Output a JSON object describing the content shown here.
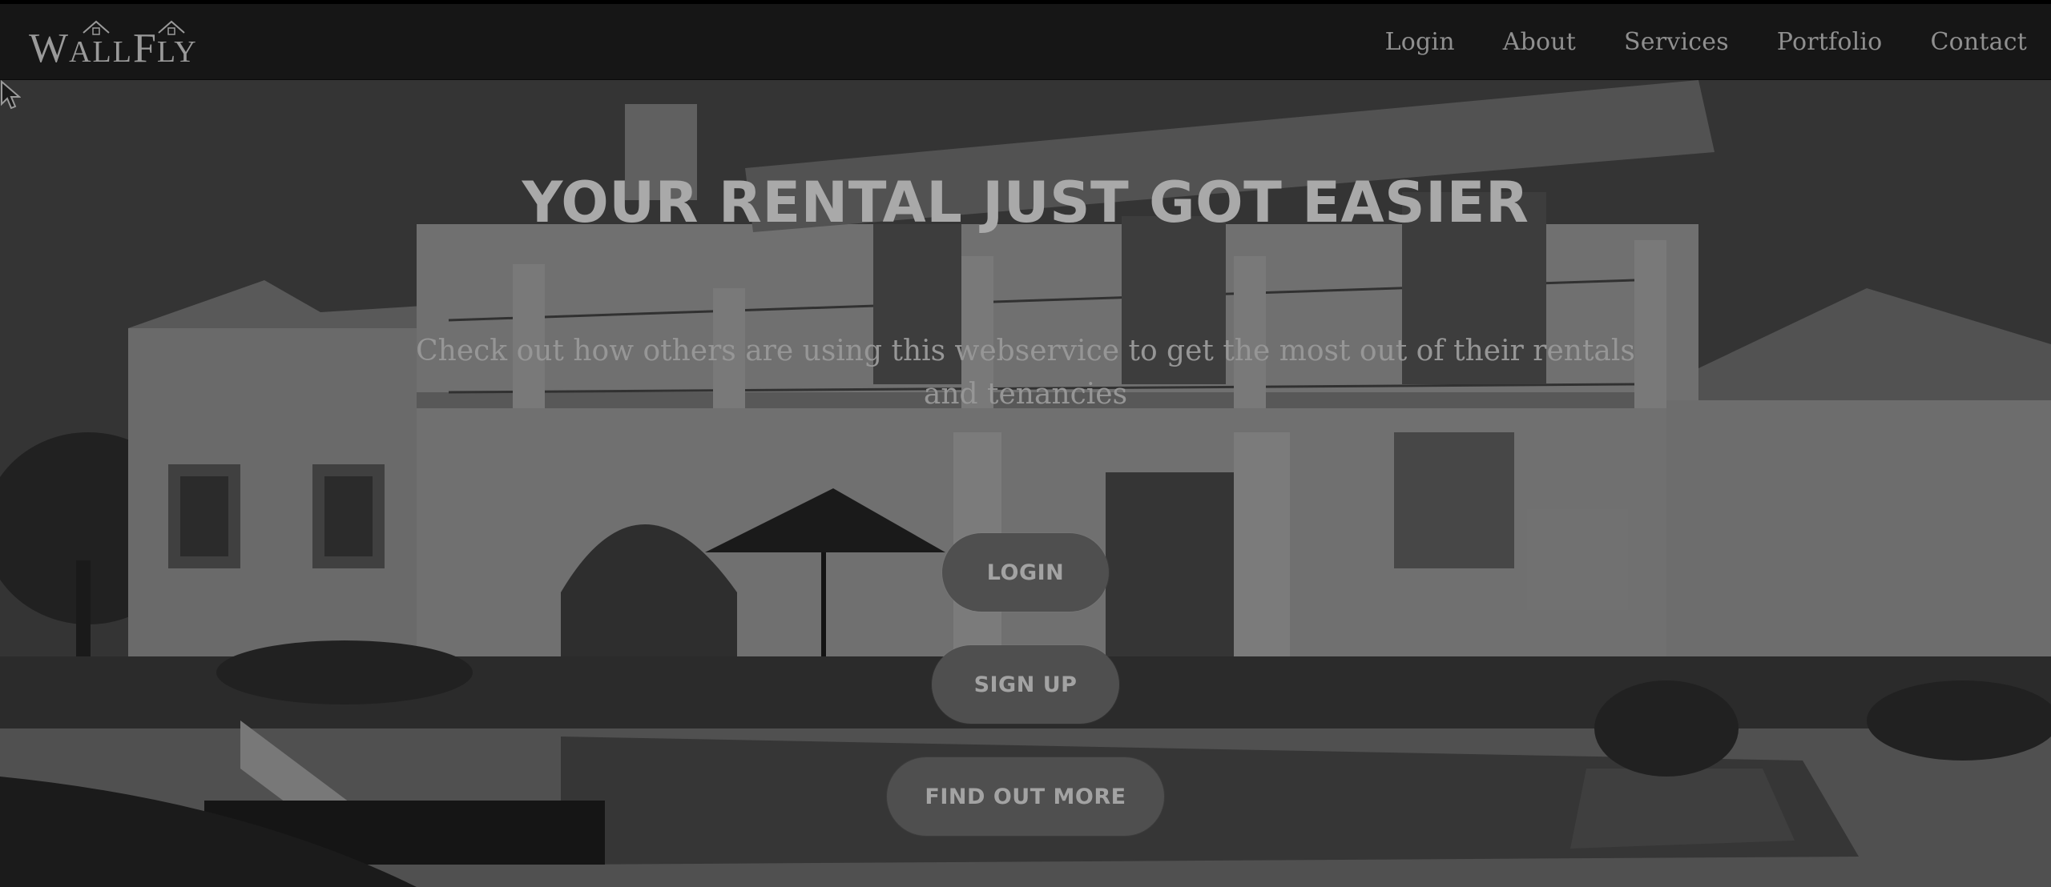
{
  "brand": {
    "logo_text_wall_initial": "W",
    "logo_text_wall_rest": "ALL",
    "logo_text_fly_initial": "F",
    "logo_text_fly_rest": "LY"
  },
  "nav": {
    "items": [
      {
        "label": "Login"
      },
      {
        "label": "About"
      },
      {
        "label": "Services"
      },
      {
        "label": "Portfolio"
      },
      {
        "label": "Contact"
      }
    ]
  },
  "hero": {
    "headline": "YOUR RENTAL JUST GOT EASIER",
    "subtitle": "Check out how others are using this webservice to get the most out of their rentals and tenancies",
    "buttons": {
      "login": "LOGIN",
      "signup": "SIGN UP",
      "find_out_more": "FIND OUT MORE"
    }
  },
  "colors": {
    "navbar_bg": "#161616",
    "button_bg": "#4f4f4f",
    "text_muted": "#a9a9a9"
  },
  "icons": {
    "cursor": "mouse-pointer-icon",
    "logo_roof": "house-roof-icon"
  }
}
